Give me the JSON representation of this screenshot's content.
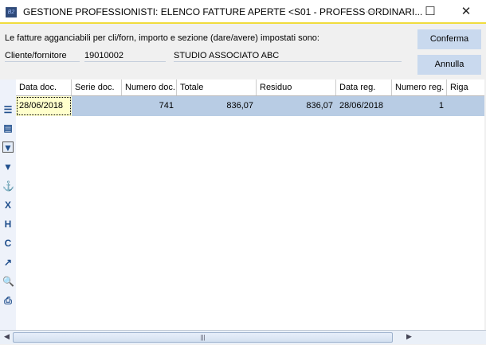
{
  "window": {
    "app_icon_text": "B2",
    "title": "GESTIONE PROFESSIONISTI: ELENCO FATTURE APERTE <S01 - PROFESS ORDINARI..."
  },
  "info": {
    "message": "Le fatture agganciabili per cli/forn, importo e sezione (dare/avere) impostati sono:",
    "label": "Cliente/fornitore",
    "code": "19010002",
    "name": "STUDIO ASSOCIATO ABC"
  },
  "buttons": {
    "confirm": "Conferma",
    "cancel": "Annulla"
  },
  "table": {
    "columns": [
      "Data doc.",
      "Serie doc.",
      "Numero doc.",
      "Totale",
      "Residuo",
      "Data reg.",
      "Numero reg.",
      "Riga"
    ],
    "rows": [
      [
        "28/06/2018",
        "",
        "741",
        "836,07",
        "836,07",
        "28/06/2018",
        "1",
        ""
      ]
    ]
  },
  "toolbar_icons": [
    "list-icon",
    "detail-list-icon",
    "filter-icon",
    "filter-remove-icon",
    "anchor-icon",
    "export-excel-icon",
    "export-html-icon",
    "export-csv-icon",
    "chart-icon",
    "preview-icon",
    "print-icon"
  ]
}
